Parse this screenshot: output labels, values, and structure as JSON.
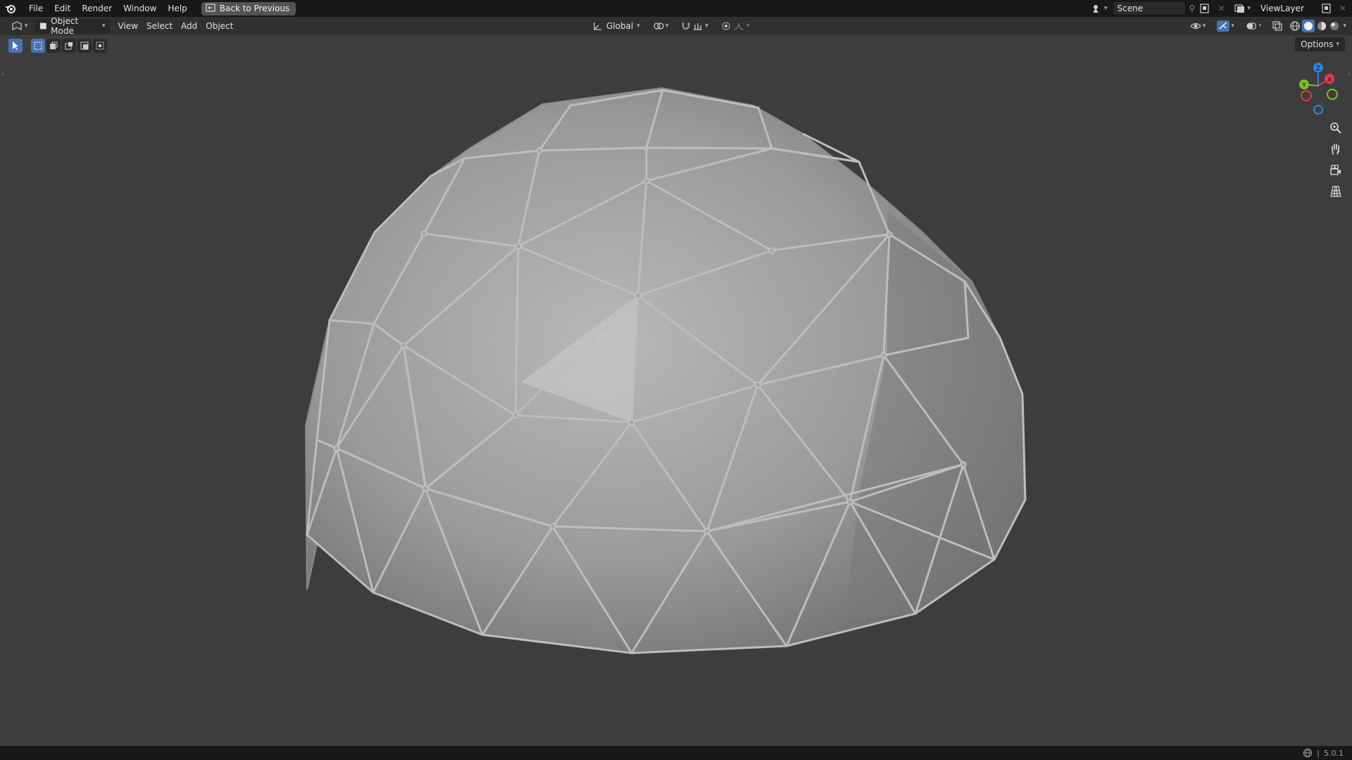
{
  "menu": {
    "file": "File",
    "edit": "Edit",
    "render": "Render",
    "window": "Window",
    "help": "Help",
    "back": "Back to Previous"
  },
  "scene": {
    "name": "Scene",
    "view_layer": "ViewLayer"
  },
  "header": {
    "mode": "Object Mode",
    "view": "View",
    "select": "Select",
    "add": "Add",
    "object": "Object",
    "orientation": "Global"
  },
  "viewport": {
    "options_label": "Options",
    "gizmo_axes": {
      "x": "X",
      "y": "Y",
      "z": "Z"
    }
  },
  "status": {
    "version": "5.0.1"
  },
  "colors": {
    "accent": "#4772b3",
    "axis_x": "#e33b4e",
    "axis_y": "#7fbf2a",
    "axis_z": "#2f84e3"
  }
}
